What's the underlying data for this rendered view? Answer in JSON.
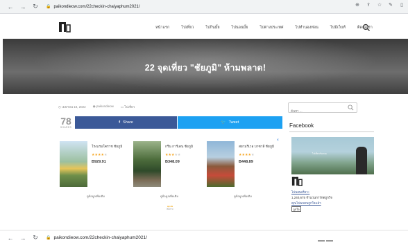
{
  "browser": {
    "url": "paikondieow.com/22checkin-chaiyaphum2021/",
    "toolbar_icons": [
      "zoom-icon",
      "share-icon",
      "star-icon",
      "extension-icon",
      "menu-icon"
    ]
  },
  "site": {
    "logo_label": "logo",
    "menu": [
      "หน้าแรก",
      "ไปเที่ยว",
      "ไปกินมั้ย",
      "ไปนอนมั้ย",
      "ไปต่างประเทศ",
      "ไปทำนองท่อน",
      "ไปมีเว็บท์",
      "ติดต่อเรา"
    ]
  },
  "article": {
    "title": "22 จุดเที่ยว \"ชัยภูมิ\" ห้ามพลาด!",
    "date": "เมษายน 18, 2022",
    "author": "paikondieow",
    "category": "ไปเที่ยว"
  },
  "share": {
    "count": "78",
    "label": "SHARES",
    "facebook_label": "Share",
    "twitter_label": "Tweet"
  },
  "ad": {
    "close_label": "×",
    "footer_line1": "agoda",
    "footer_line2": "ติดตาม",
    "hotels": [
      {
        "name": "โรงแรมโคราช ชัยภูมิ",
        "rating": 4,
        "price": "B929.91",
        "button": "ดูข้อมูลเพิ่มเติม"
      },
      {
        "name": "กรีน การ์เดน ชัยภูมิ",
        "rating": 3,
        "price": "B348.09",
        "button": "ดูข้อมูลเพิ่มเติม"
      },
      {
        "name": "สยามรีเวอ บาซาลี ชัยภูมิ",
        "rating": 4,
        "price": "B448.89",
        "button": "ดูข้อมูลเพิ่มเติม"
      }
    ]
  },
  "sidebar": {
    "search_placeholder": "ค้นหา ...",
    "widget_title": "Facebook",
    "cover_text": "ไปเที่ยวกันเถอะ",
    "page_name": "ไปนอนเที่ยว+",
    "likes": "1,240,675 จำนวนการกดถูกใจ",
    "liked_text": "คุณไปพบคนถูกใจแล้ว",
    "like_button": "ถูกใจ"
  },
  "browser_bottom": {
    "url": "paikondieow.com/22checkin-chaiyaphum2021/"
  }
}
